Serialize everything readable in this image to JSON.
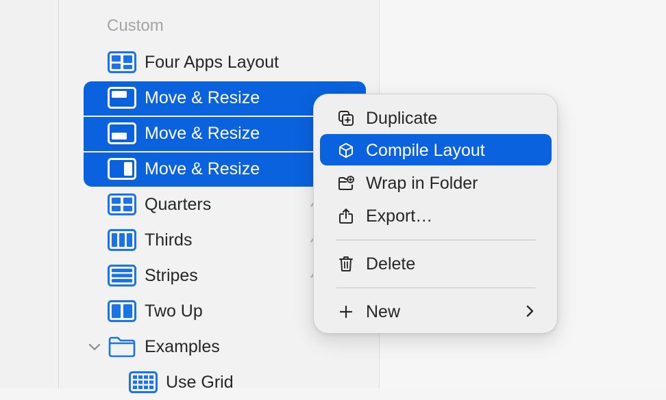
{
  "sidebar": {
    "section_header": "Custom",
    "items": [
      {
        "label": "Four Apps Layout",
        "icon": "four-apps-layout-icon"
      },
      {
        "label": "Move & Resize",
        "icon": "move-resize-top-icon"
      },
      {
        "label": "Move & Resize",
        "icon": "move-resize-bottom-icon"
      },
      {
        "label": "Move & Resize",
        "icon": "move-resize-right-icon"
      },
      {
        "label": "Quarters",
        "icon": "quarters-icon"
      },
      {
        "label": "Thirds",
        "icon": "thirds-icon"
      },
      {
        "label": "Stripes",
        "icon": "stripes-icon"
      },
      {
        "label": "Two Up",
        "icon": "two-up-icon"
      },
      {
        "label": "Examples",
        "icon": "folder-icon"
      },
      {
        "label": "Use Grid",
        "icon": "grid-icon"
      }
    ]
  },
  "context_menu": {
    "items": [
      {
        "label": "Duplicate",
        "icon": "duplicate-icon"
      },
      {
        "label": "Compile Layout",
        "icon": "cube-icon"
      },
      {
        "label": "Wrap in Folder",
        "icon": "folder-plus-icon"
      },
      {
        "label": "Export…",
        "icon": "share-icon"
      },
      {
        "label": "Delete",
        "icon": "trash-icon"
      },
      {
        "label": "New",
        "icon": "plus-icon"
      }
    ]
  },
  "colors": {
    "accent": "#0a62de",
    "icon_blue": "#1a73e8",
    "text": "#262626",
    "section_header": "#a3a3a3"
  }
}
